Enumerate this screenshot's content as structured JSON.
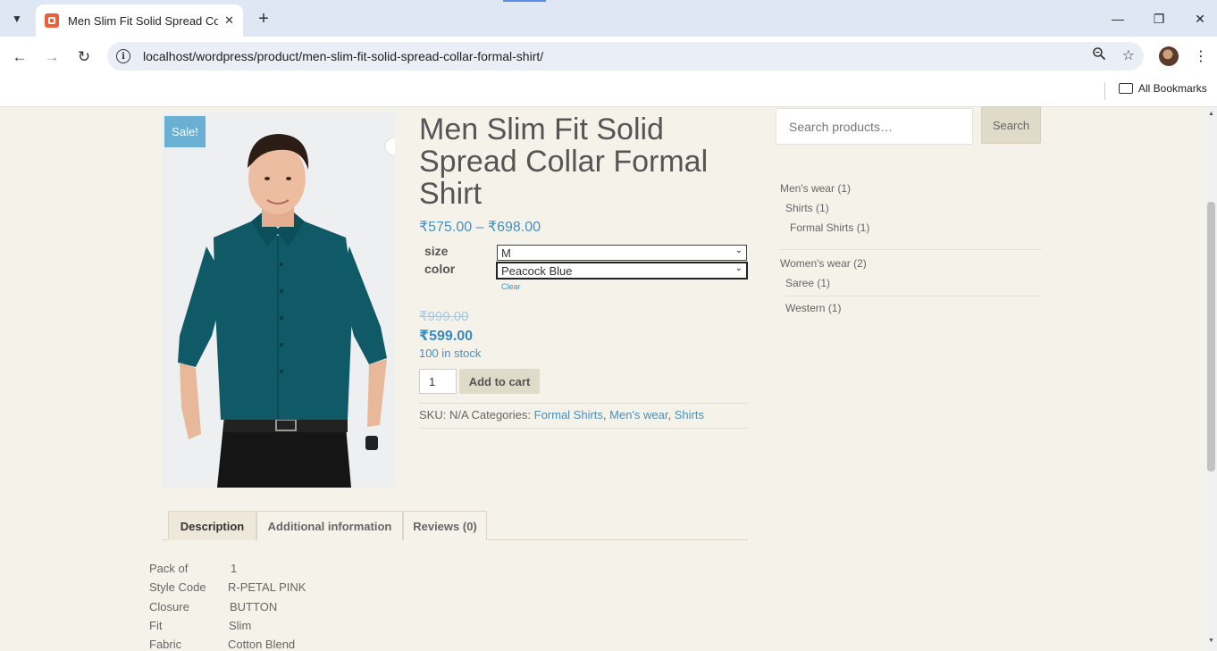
{
  "browser": {
    "tab_title": "Men Slim Fit Solid Spread Colla",
    "url": "localhost/wordpress/product/men-slim-fit-solid-spread-collar-formal-shirt/",
    "bookmarks_label": "All Bookmarks"
  },
  "product": {
    "sale_badge": "Sale!",
    "title": "Men Slim Fit Solid Spread Collar Formal Shirt",
    "price_range": "₹575.00 – ₹698.00",
    "variations": {
      "size_label": "size",
      "size_value": "M",
      "color_label": "color",
      "color_value": "Peacock Blue",
      "clear_label": "Clear"
    },
    "old_price": "₹999.00",
    "new_price": "₹599.00",
    "stock": "100 in stock",
    "quantity": "1",
    "add_to_cart": "Add to cart",
    "meta": {
      "sku_text": "SKU: N/A Categories:",
      "categories": [
        "Formal Shirts",
        "Men's wear",
        "Shirts"
      ]
    }
  },
  "tabs": [
    {
      "label": "Description"
    },
    {
      "label": "Additional information"
    },
    {
      "label": "Reviews (0)"
    }
  ],
  "attributes": [
    {
      "name": "Pack of",
      "value": "1"
    },
    {
      "name": "Style Code",
      "value": "R-PETAL PINK"
    },
    {
      "name": "Closure",
      "value": "BUTTON"
    },
    {
      "name": "Fit",
      "value": "Slim"
    },
    {
      "name": "Fabric",
      "value": "Cotton Blend"
    }
  ],
  "sidebar": {
    "search_placeholder": "Search products…",
    "search_button": "Search",
    "categories": [
      {
        "label": "Men's wear",
        "count": "(1)"
      },
      {
        "label": "Shirts",
        "count": "(1)"
      },
      {
        "label": "Formal Shirts",
        "count": "(1)"
      },
      {
        "label": "Women's wear",
        "count": "(2)"
      },
      {
        "label": "Saree",
        "count": "(1)"
      },
      {
        "label": "Western",
        "count": "(1)"
      }
    ]
  },
  "colors": {
    "accent_link": "#4a8fbd",
    "sale_badge": "#6ab0d4",
    "page_bg": "#f5f2ea",
    "shirt": "#0f5a66"
  }
}
